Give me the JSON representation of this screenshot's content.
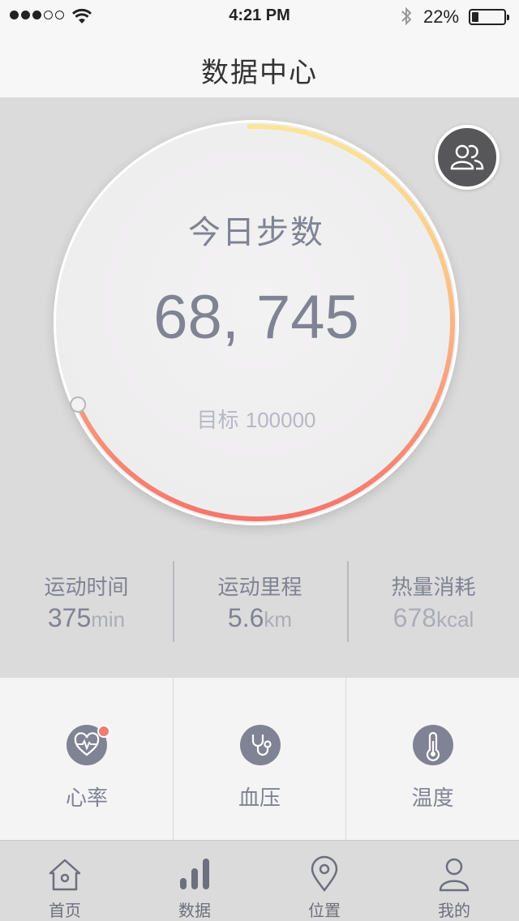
{
  "status_bar": {
    "signal_filled": 3,
    "signal_total": 5,
    "time": "4:21 PM",
    "battery_percent": "22%",
    "battery_level": 0.22
  },
  "header": {
    "title": "数据中心"
  },
  "steps": {
    "label": "今日步数",
    "value": "68, 745",
    "goal_label": "目标",
    "goal_value": "100000",
    "progress_fraction": 0.687,
    "ring_colors": [
      "#fbe59a",
      "#fbc98a",
      "#f7a27f",
      "#f5756a"
    ]
  },
  "stats": [
    {
      "label": "运动时间",
      "value": "375",
      "unit": "min"
    },
    {
      "label": "运动里程",
      "value": "5.6",
      "unit": "km"
    },
    {
      "label": "热量消耗",
      "value": "678",
      "unit": "kcal"
    }
  ],
  "features": [
    {
      "label": "心率",
      "icon": "heart-rate-icon"
    },
    {
      "label": "血压",
      "icon": "stethoscope-icon"
    },
    {
      "label": "温度",
      "icon": "thermometer-icon"
    }
  ],
  "tabs": [
    {
      "label": "首页",
      "icon": "home-icon"
    },
    {
      "label": "数据",
      "icon": "bar-chart-icon"
    },
    {
      "label": "位置",
      "icon": "location-pin-icon"
    },
    {
      "label": "我的",
      "icon": "user-icon"
    }
  ],
  "colors": {
    "primary_text": "#7F8393",
    "muted_text": "#ABADB6",
    "accent_red": "#f07d70",
    "panel_gray": "#dcdbdc"
  }
}
